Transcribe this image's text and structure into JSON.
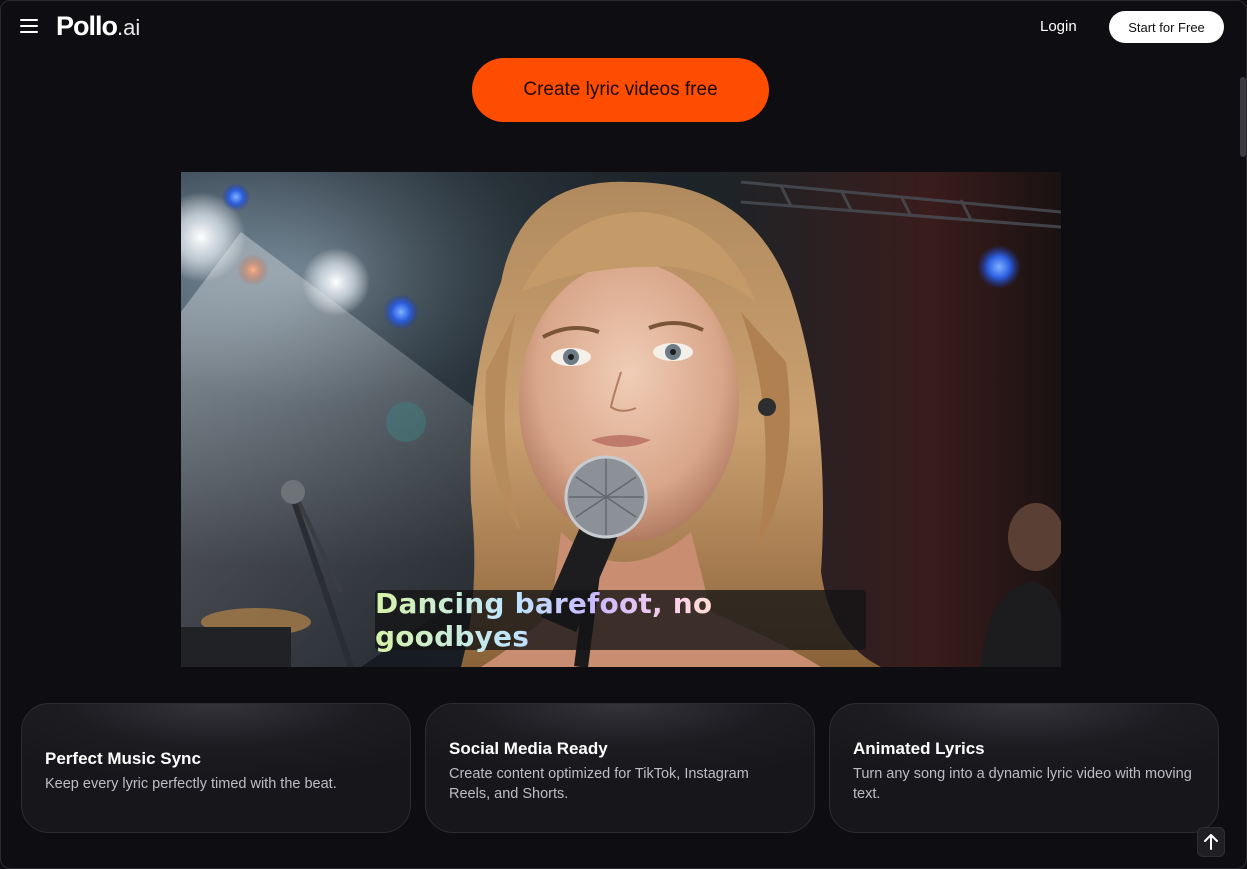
{
  "header": {
    "logo_main": "Pollo",
    "logo_suffix": ".ai",
    "login_label": "Login",
    "start_label": "Start for Free"
  },
  "hero": {
    "cta_label": "Create lyric videos free"
  },
  "video": {
    "caption": "Dancing barefoot, no goodbyes"
  },
  "features": [
    {
      "title": "Perfect Music Sync",
      "description": "Keep every lyric perfectly timed with the beat."
    },
    {
      "title": "Social Media Ready",
      "description": "Create content optimized for TikTok, Instagram Reels, and Shorts."
    },
    {
      "title": "Animated Lyrics",
      "description": "Turn any song into a dynamic lyric video with moving text."
    }
  ],
  "icons": {
    "menu": "hamburger-menu-icon",
    "back_to_top": "arrow-up-icon"
  },
  "colors": {
    "background": "#0e0e12",
    "cta": "#ff4d00",
    "start_button": "#ffffff"
  }
}
